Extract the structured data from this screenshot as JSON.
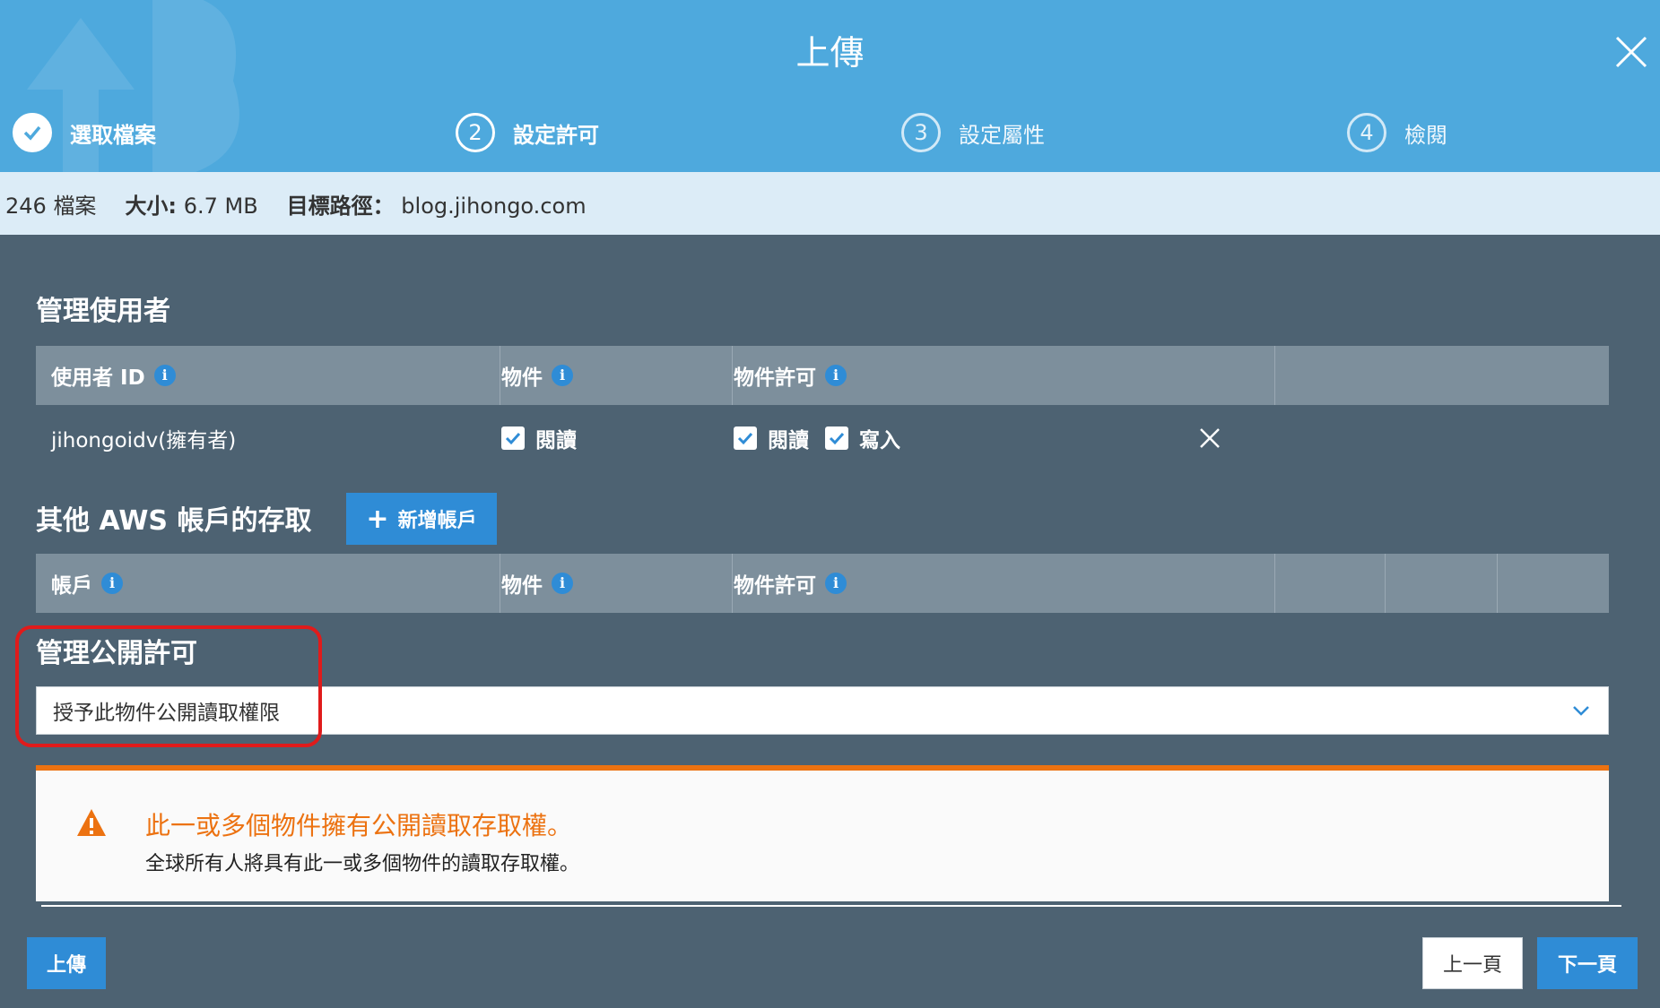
{
  "header": {
    "title": "上傳",
    "close_icon": "close-icon"
  },
  "steps": [
    {
      "number": "1",
      "label": "選取檔案",
      "state": "done"
    },
    {
      "number": "2",
      "label": "設定許可",
      "state": "active"
    },
    {
      "number": "3",
      "label": "設定屬性",
      "state": "pending"
    },
    {
      "number": "4",
      "label": "檢閱",
      "state": "pending"
    }
  ],
  "infobar": {
    "files": "246 檔案",
    "size_label": "大小:",
    "size_value": "6.7 MB",
    "target_label": "目標路徑：",
    "target_value": "blog.jihongo.com"
  },
  "manage_users": {
    "title": "管理使用者",
    "columns": [
      "使用者 ID",
      "物件",
      "物件許可"
    ],
    "rows": [
      {
        "user": "jihongoidv(擁有者)",
        "object_read": "閱讀",
        "perm_read": "閱讀",
        "perm_write": "寫入"
      }
    ]
  },
  "other_accounts": {
    "title": "其他 AWS 帳戶的存取",
    "add_button": "新增帳戶",
    "columns": [
      "帳戶",
      "物件",
      "物件許可"
    ]
  },
  "public_permissions": {
    "title": "管理公開許可",
    "selected": "授予此物件公開讀取權限"
  },
  "warning": {
    "title": "此一或多個物件擁有公開讀取存取權。",
    "body": "全球所有人將具有此一或多個物件的讀取存取權。"
  },
  "footer": {
    "upload": "上傳",
    "prev": "上一頁",
    "next": "下一頁"
  },
  "colors": {
    "header_bg": "#4ea9dd",
    "body_bg": "#4d6272",
    "accent": "#2f8cd6",
    "warning": "#ec7211",
    "highlight": "#e01b1b"
  }
}
